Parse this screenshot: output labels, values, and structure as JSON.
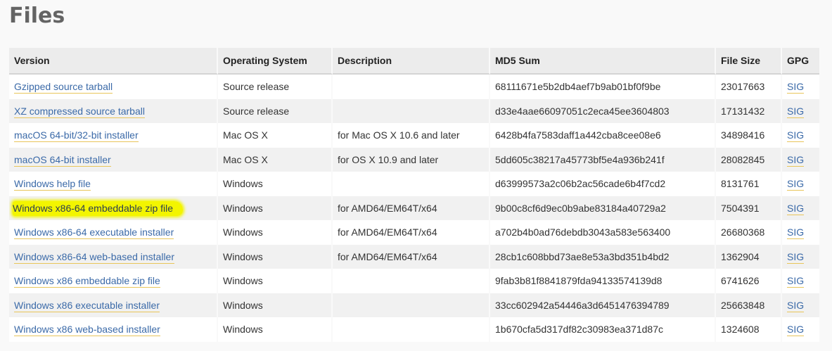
{
  "page": {
    "title": "Files"
  },
  "table": {
    "headers": {
      "version": "Version",
      "os": "Operating System",
      "description": "Description",
      "md5": "MD5 Sum",
      "size": "File Size",
      "gpg": "GPG"
    },
    "rows": [
      {
        "version": "Gzipped source tarball",
        "os": "Source release",
        "description": "",
        "md5": "68111671e5b2db4aef7b9ab01bf0f9be",
        "size": "23017663",
        "gpg": "SIG",
        "highlighted": false
      },
      {
        "version": "XZ compressed source tarball",
        "os": "Source release",
        "description": "",
        "md5": "d33e4aae66097051c2eca45ee3604803",
        "size": "17131432",
        "gpg": "SIG",
        "highlighted": false
      },
      {
        "version": "macOS 64-bit/32-bit installer",
        "os": "Mac OS X",
        "description": "for Mac OS X 10.6 and later",
        "md5": "6428b4fa7583daff1a442cba8cee08e6",
        "size": "34898416",
        "gpg": "SIG",
        "highlighted": false
      },
      {
        "version": "macOS 64-bit installer",
        "os": "Mac OS X",
        "description": "for OS X 10.9 and later",
        "md5": "5dd605c38217a45773bf5e4a936b241f",
        "size": "28082845",
        "gpg": "SIG",
        "highlighted": false
      },
      {
        "version": "Windows help file",
        "os": "Windows",
        "description": "",
        "md5": "d63999573a2c06b2ac56cade6b4f7cd2",
        "size": "8131761",
        "gpg": "SIG",
        "highlighted": false
      },
      {
        "version": "Windows x86-64 embeddable zip file",
        "os": "Windows",
        "description": "for AMD64/EM64T/x64",
        "md5": "9b00c8cf6d9ec0b9abe83184a40729a2",
        "size": "7504391",
        "gpg": "SIG",
        "highlighted": true
      },
      {
        "version": "Windows x86-64 executable installer",
        "os": "Windows",
        "description": "for AMD64/EM64T/x64",
        "md5": "a702b4b0ad76debdb3043a583e563400",
        "size": "26680368",
        "gpg": "SIG",
        "highlighted": false
      },
      {
        "version": "Windows x86-64 web-based installer",
        "os": "Windows",
        "description": "for AMD64/EM64T/x64",
        "md5": "28cb1c608bbd73ae8e53a3bd351b4bd2",
        "size": "1362904",
        "gpg": "SIG",
        "highlighted": false
      },
      {
        "version": "Windows x86 embeddable zip file",
        "os": "Windows",
        "description": "",
        "md5": "9fab3b81f8841879fda94133574139d8",
        "size": "6741626",
        "gpg": "SIG",
        "highlighted": false
      },
      {
        "version": "Windows x86 executable installer",
        "os": "Windows",
        "description": "",
        "md5": "33cc602942a54446a3d6451476394789",
        "size": "25663848",
        "gpg": "SIG",
        "highlighted": false
      },
      {
        "version": "Windows x86 web-based installer",
        "os": "Windows",
        "description": "",
        "md5": "1b670cfa5d317df82c30983ea371d87c",
        "size": "1324608",
        "gpg": "SIG",
        "highlighted": false
      }
    ]
  },
  "colors": {
    "link": "#3b6aa8",
    "link_underline": "#e8c55a",
    "highlight": "#f3f500",
    "title": "#646464"
  }
}
